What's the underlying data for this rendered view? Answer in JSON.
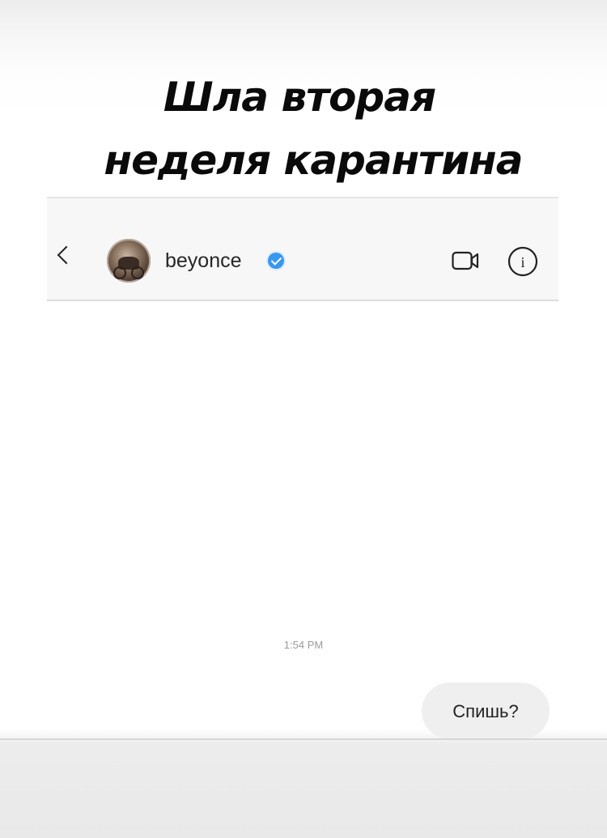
{
  "caption": {
    "line1": "Шла вторая",
    "line2": "неделя карантина"
  },
  "header": {
    "back_icon": "chevron-left-icon",
    "username": "beyonce",
    "verified_icon": "verified-badge-icon",
    "video_icon": "video-call-icon",
    "info_icon": "info-icon",
    "info_glyph": "i",
    "accent_color": "#3897f0"
  },
  "thread": {
    "timestamp": "1:54 PM",
    "messages": [
      {
        "text": "Спишь?",
        "from": "me"
      }
    ]
  }
}
